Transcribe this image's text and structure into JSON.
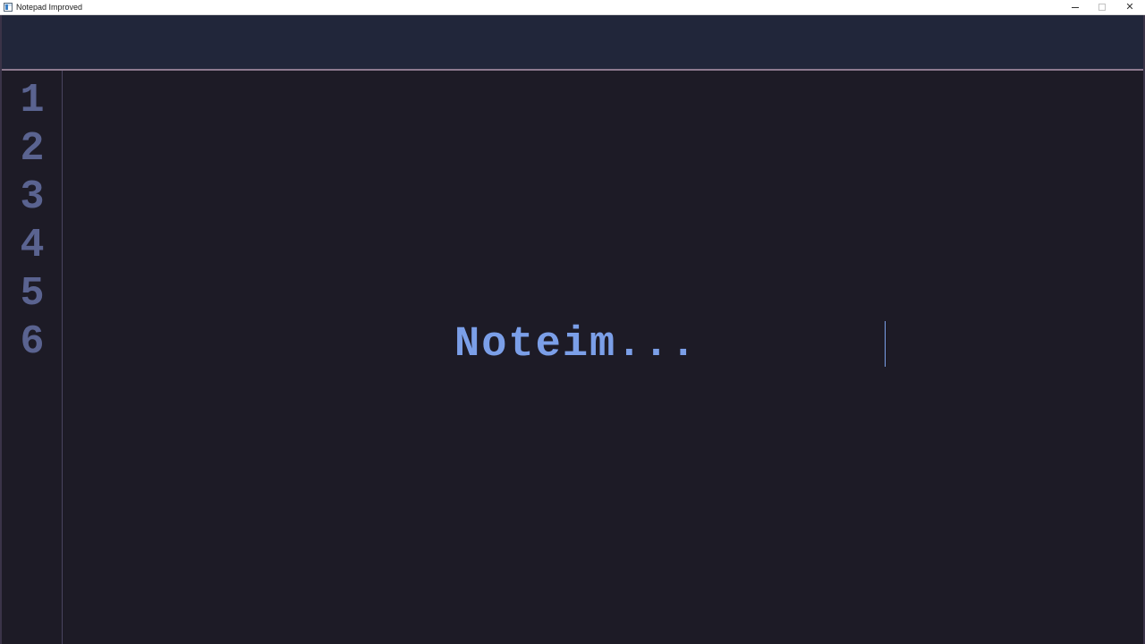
{
  "window": {
    "title": "Notepad Improved",
    "minimize_glyph": "—",
    "maximize_glyph": "□",
    "close_glyph": "✕"
  },
  "editor": {
    "line_numbers": [
      "1",
      "2",
      "3",
      "4",
      "5",
      "6"
    ],
    "lines": [
      "",
      "",
      "",
      "",
      "",
      "Noteim..."
    ],
    "cursor_line": 6
  },
  "colors": {
    "background": "#1d1b26",
    "toolbar": "#21263a",
    "line_number": "#5a6390",
    "text": "#7b9fe8"
  },
  "icons": {
    "app": "notepad-app-icon",
    "minimize": "minimize-icon",
    "maximize": "maximize-icon",
    "close": "close-icon"
  }
}
